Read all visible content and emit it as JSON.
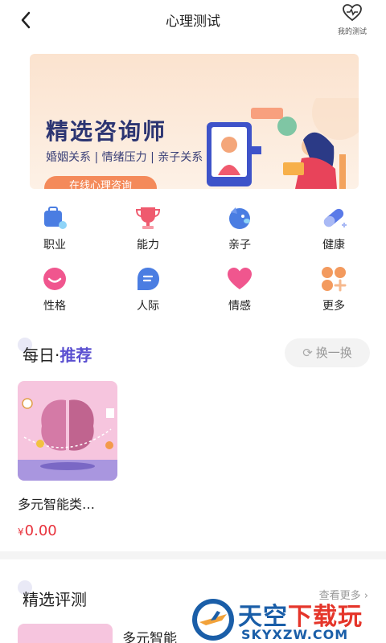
{
  "header": {
    "title": "心理测试",
    "my_tests_label": "我的测试"
  },
  "banner": {
    "title": "精选咨询师",
    "subtitle": "婚姻关系 | 情绪压力 | 亲子关系",
    "button": "在线心理咨询"
  },
  "categories": [
    {
      "label": "职业",
      "icon": "briefcase-icon",
      "color": "#4a7de2"
    },
    {
      "label": "能力",
      "icon": "trophy-icon",
      "color": "#ef5a6e"
    },
    {
      "label": "亲子",
      "icon": "dog-icon",
      "color": "#4a7de2"
    },
    {
      "label": "健康",
      "icon": "pill-icon",
      "color": "#5a7ae8"
    },
    {
      "label": "性格",
      "icon": "smile-icon",
      "color": "#f0568e"
    },
    {
      "label": "人际",
      "icon": "chat-icon",
      "color": "#4a7de2"
    },
    {
      "label": "情感",
      "icon": "heart-icon",
      "color": "#f0568e"
    },
    {
      "label": "更多",
      "icon": "more-icon",
      "color": "#f39a5e"
    }
  ],
  "daily": {
    "title_prefix": "每日·",
    "title_accent": "推荐",
    "swap_label": "换一换",
    "item": {
      "name": "多元智能类…",
      "currency": "¥",
      "price": "0.00"
    }
  },
  "featured": {
    "title": "精选评测",
    "more_label": "查看更多 ›",
    "item_name": "多元智能"
  },
  "watermark": {
    "text_blue": "天空",
    "text_red": "下载玩",
    "url": "SKYXZW.COM"
  },
  "colors": {
    "accent": "#5a4fd0",
    "price": "#e8323c",
    "banner_bg": "#fbe3cf"
  }
}
